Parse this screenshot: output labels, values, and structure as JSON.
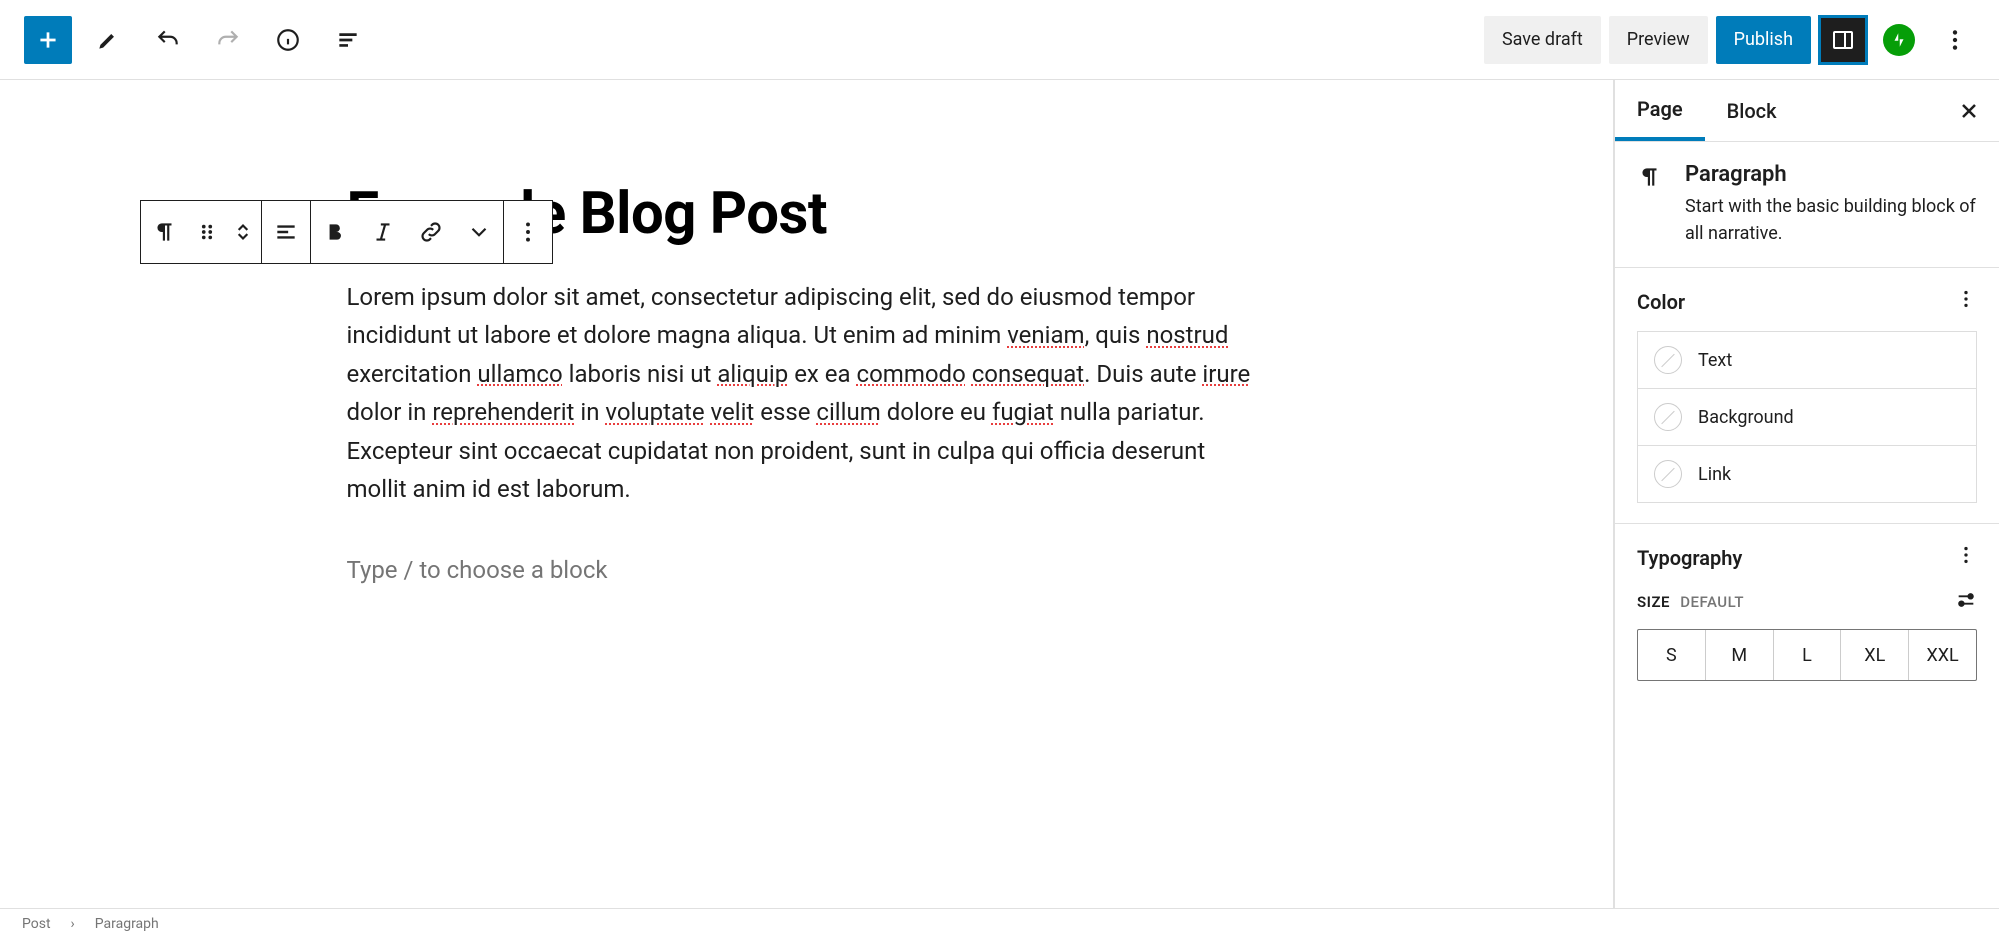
{
  "topbar": {
    "save_draft": "Save draft",
    "preview": "Preview",
    "publish": "Publish"
  },
  "editor": {
    "title": "Example Blog Post",
    "paragraph_parts": [
      {
        "t": "Lorem ipsum dolor sit amet, consectetur adipiscing elit, sed do eiusmod tempor incididunt ut labore et dolore magna aliqua. Ut enim ad minim "
      },
      {
        "t": "veniam",
        "s": true
      },
      {
        "t": ", quis "
      },
      {
        "t": "nostrud",
        "s": true
      },
      {
        "t": " exercitation "
      },
      {
        "t": "ullamco",
        "s": true
      },
      {
        "t": " laboris nisi ut "
      },
      {
        "t": "aliquip",
        "s": true
      },
      {
        "t": " ex ea "
      },
      {
        "t": "commodo",
        "s": true
      },
      {
        "t": " "
      },
      {
        "t": "consequat",
        "s": true
      },
      {
        "t": ". Duis aute "
      },
      {
        "t": "irure",
        "s": true
      },
      {
        "t": " dolor in "
      },
      {
        "t": "reprehenderit",
        "s": true
      },
      {
        "t": " in "
      },
      {
        "t": "voluptate",
        "s": true
      },
      {
        "t": " "
      },
      {
        "t": "velit",
        "s": true
      },
      {
        "t": " esse "
      },
      {
        "t": "cillum",
        "s": true
      },
      {
        "t": " dolore eu "
      },
      {
        "t": "fugiat",
        "s": true
      },
      {
        "t": " nulla pariatur. Excepteur sint occaecat cupidatat non proident, sunt in culpa qui officia deserunt mollit anim id est laborum."
      }
    ],
    "placeholder": "Type / to choose a block"
  },
  "sidebar": {
    "tabs": {
      "page": "Page",
      "block": "Block"
    },
    "block": {
      "name": "Paragraph",
      "description": "Start with the basic building block of all narrative."
    },
    "color": {
      "title": "Color",
      "items": [
        "Text",
        "Background",
        "Link"
      ]
    },
    "typography": {
      "title": "Typography",
      "size_label": "SIZE",
      "size_default": "DEFAULT",
      "sizes": [
        "S",
        "M",
        "L",
        "XL",
        "XXL"
      ]
    }
  },
  "footer": {
    "crumb1": "Post",
    "crumb2": "Paragraph"
  }
}
